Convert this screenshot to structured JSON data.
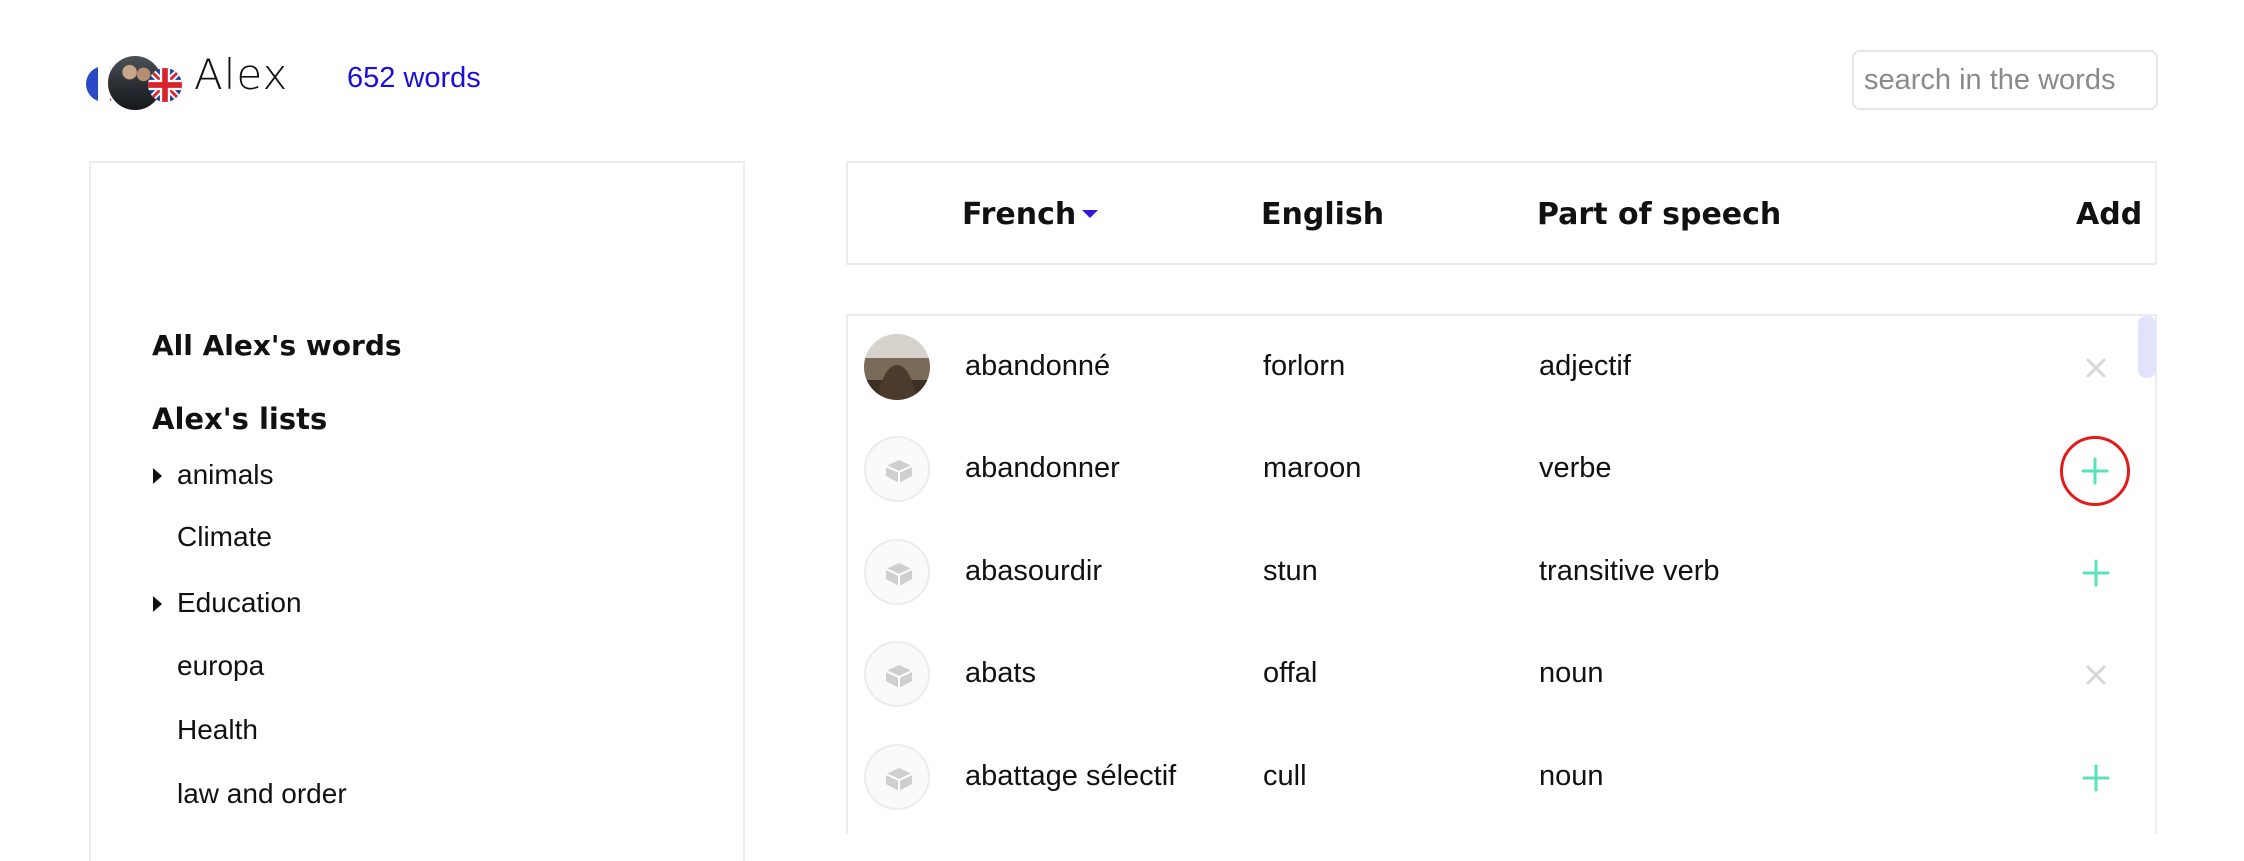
{
  "header": {
    "user_name": "Alex",
    "word_count": "652 words",
    "search_placeholder": "search in the words"
  },
  "sidebar": {
    "all_words": "All Alex's words",
    "lists_title": "Alex's lists",
    "lists": [
      {
        "label": "animals",
        "expandable": true
      },
      {
        "label": "Climate",
        "expandable": false
      },
      {
        "label": "Education",
        "expandable": true
      },
      {
        "label": "europa",
        "expandable": false
      },
      {
        "label": "Health",
        "expandable": false
      },
      {
        "label": "law and order",
        "expandable": false
      }
    ]
  },
  "table": {
    "columns": {
      "french": "French",
      "english": "English",
      "pos": "Part of speech",
      "add": "Add"
    },
    "rows": [
      {
        "french": "abandonné",
        "english": "forlorn",
        "pos": "adjectif",
        "action": "remove",
        "thumb": "photo"
      },
      {
        "french": "abandonner",
        "english": "maroon",
        "pos": "verbe",
        "action": "add",
        "thumb": "placeholder"
      },
      {
        "french": "abasourdir",
        "english": "stun",
        "pos": "transitive verb",
        "action": "add",
        "thumb": "placeholder"
      },
      {
        "french": "abats",
        "english": "offal",
        "pos": "noun",
        "action": "remove",
        "thumb": "placeholder"
      },
      {
        "french": "abattage sélectif",
        "english": "cull",
        "pos": "noun",
        "action": "add",
        "thumb": "placeholder"
      }
    ]
  },
  "colors": {
    "link": "#1a0fd8",
    "sort_caret": "#3314e0",
    "add_icon": "#59e3bd",
    "remove_icon": "#d6d6d6",
    "highlight_ring": "#e21b1b",
    "scrollbar": "#e1e3fb"
  }
}
